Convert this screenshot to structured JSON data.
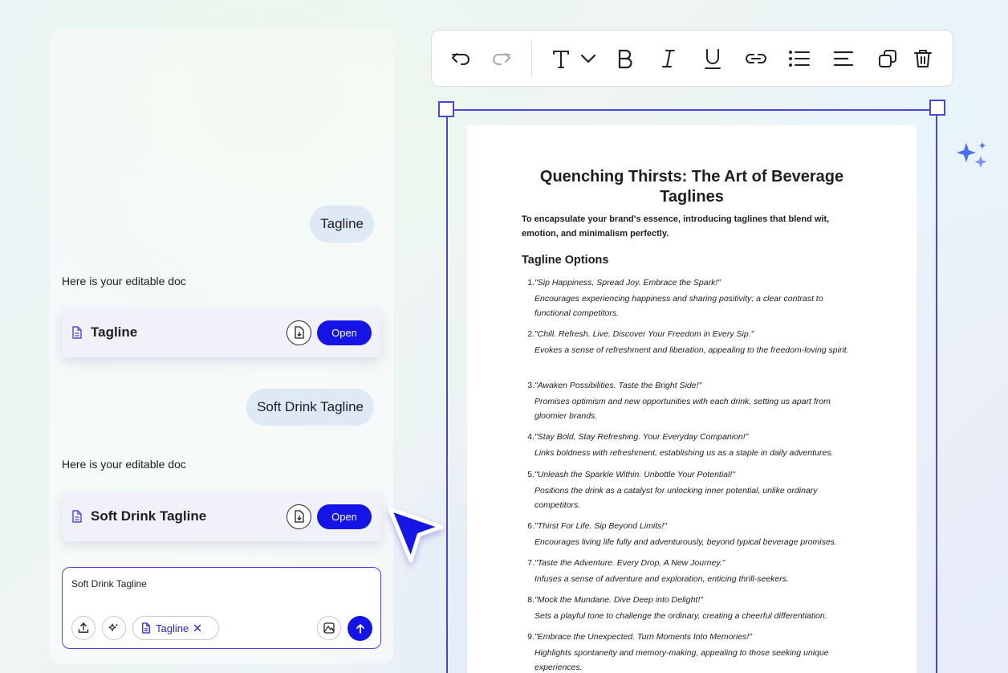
{
  "chat": {
    "messages": [
      {
        "role": "user",
        "text": "Tagline"
      },
      {
        "role": "assistant",
        "text": "Here is your editable doc",
        "doc_title": "Tagline",
        "open_label": "Open"
      },
      {
        "role": "user",
        "text": "Soft Drink Tagline"
      },
      {
        "role": "assistant",
        "text": "Here is your editable doc",
        "doc_title": "Soft Drink Tagline",
        "open_label": "Open"
      }
    ],
    "composer": {
      "value": "Soft Drink Tagline",
      "attachment_chip": "Tagline"
    }
  },
  "toolbar": {
    "icons": [
      "undo-icon",
      "redo-icon",
      "text-style-icon",
      "chevron-down-icon",
      "bold-icon",
      "italic-icon",
      "underline-icon",
      "link-icon",
      "bullet-list-icon",
      "align-icon",
      "duplicate-icon",
      "delete-icon"
    ]
  },
  "document": {
    "title": "Quenching Thirsts: The Art of Beverage Taglines",
    "intro": "To encapsulate your brand's essence, introducing taglines that blend wit, emotion, and minimalism perfectly.",
    "section_heading": "Tagline Options",
    "options": [
      {
        "num": "1.",
        "tagline": "\"Sip Happiness, Spread Joy. Embrace the Spark!\"",
        "desc": "Encourages experiencing happiness and sharing positivity; a clear contrast to functional competitors."
      },
      {
        "num": "2.",
        "tagline": "\"Chill. Refresh. Live. Discover Your Freedom in Every Sip.\"",
        "desc": "Evokes a sense of refreshment and liberation, appealing to the freedom-loving spirit."
      },
      {
        "num": "3.",
        "tagline": "\"Awaken Possibilities. Taste the Bright Side!\"",
        "desc": "Promises optimism and new opportunities with each drink, setting us apart from gloomier brands."
      },
      {
        "num": "4.",
        "tagline": "\"Stay Bold, Stay Refreshing. Your Everyday Companion!\"",
        "desc": "Links boldness with refreshment, establishing us as a staple in daily adventures."
      },
      {
        "num": "5.",
        "tagline": "\"Unleash the Sparkle Within. Unbottle Your Potential!\"",
        "desc": "Positions the drink as a catalyst for unlocking inner potential, unlike ordinary competitors."
      },
      {
        "num": "6.",
        "tagline": "\"Thirst For Life. Sip Beyond Limits!\"",
        "desc": "Encourages living life fully and adventurously, beyond typical beverage promises."
      },
      {
        "num": "7.",
        "tagline": "\"Taste the Adventure. Every Drop, A New Journey.\"",
        "desc": "Infuses a sense of adventure and exploration, enticing thrill-seekers."
      },
      {
        "num": "8.",
        "tagline": "\"Mock the Mundane. Dive Deep into Delight!\"",
        "desc": "Sets a playful tone to challenge the ordinary, creating a cheerful differentiation."
      },
      {
        "num": "9.",
        "tagline": "\"Embrace the Unexpected. Turn Moments Into Memories!\"",
        "desc": "Highlights spontaneity and memory-making, appealing to those seeking unique experiences."
      }
    ]
  },
  "colors": {
    "accent": "#1414e6",
    "selection": "#4848d8",
    "bubble": "#dfe9f6",
    "sparkle": "#4a6ef0"
  }
}
